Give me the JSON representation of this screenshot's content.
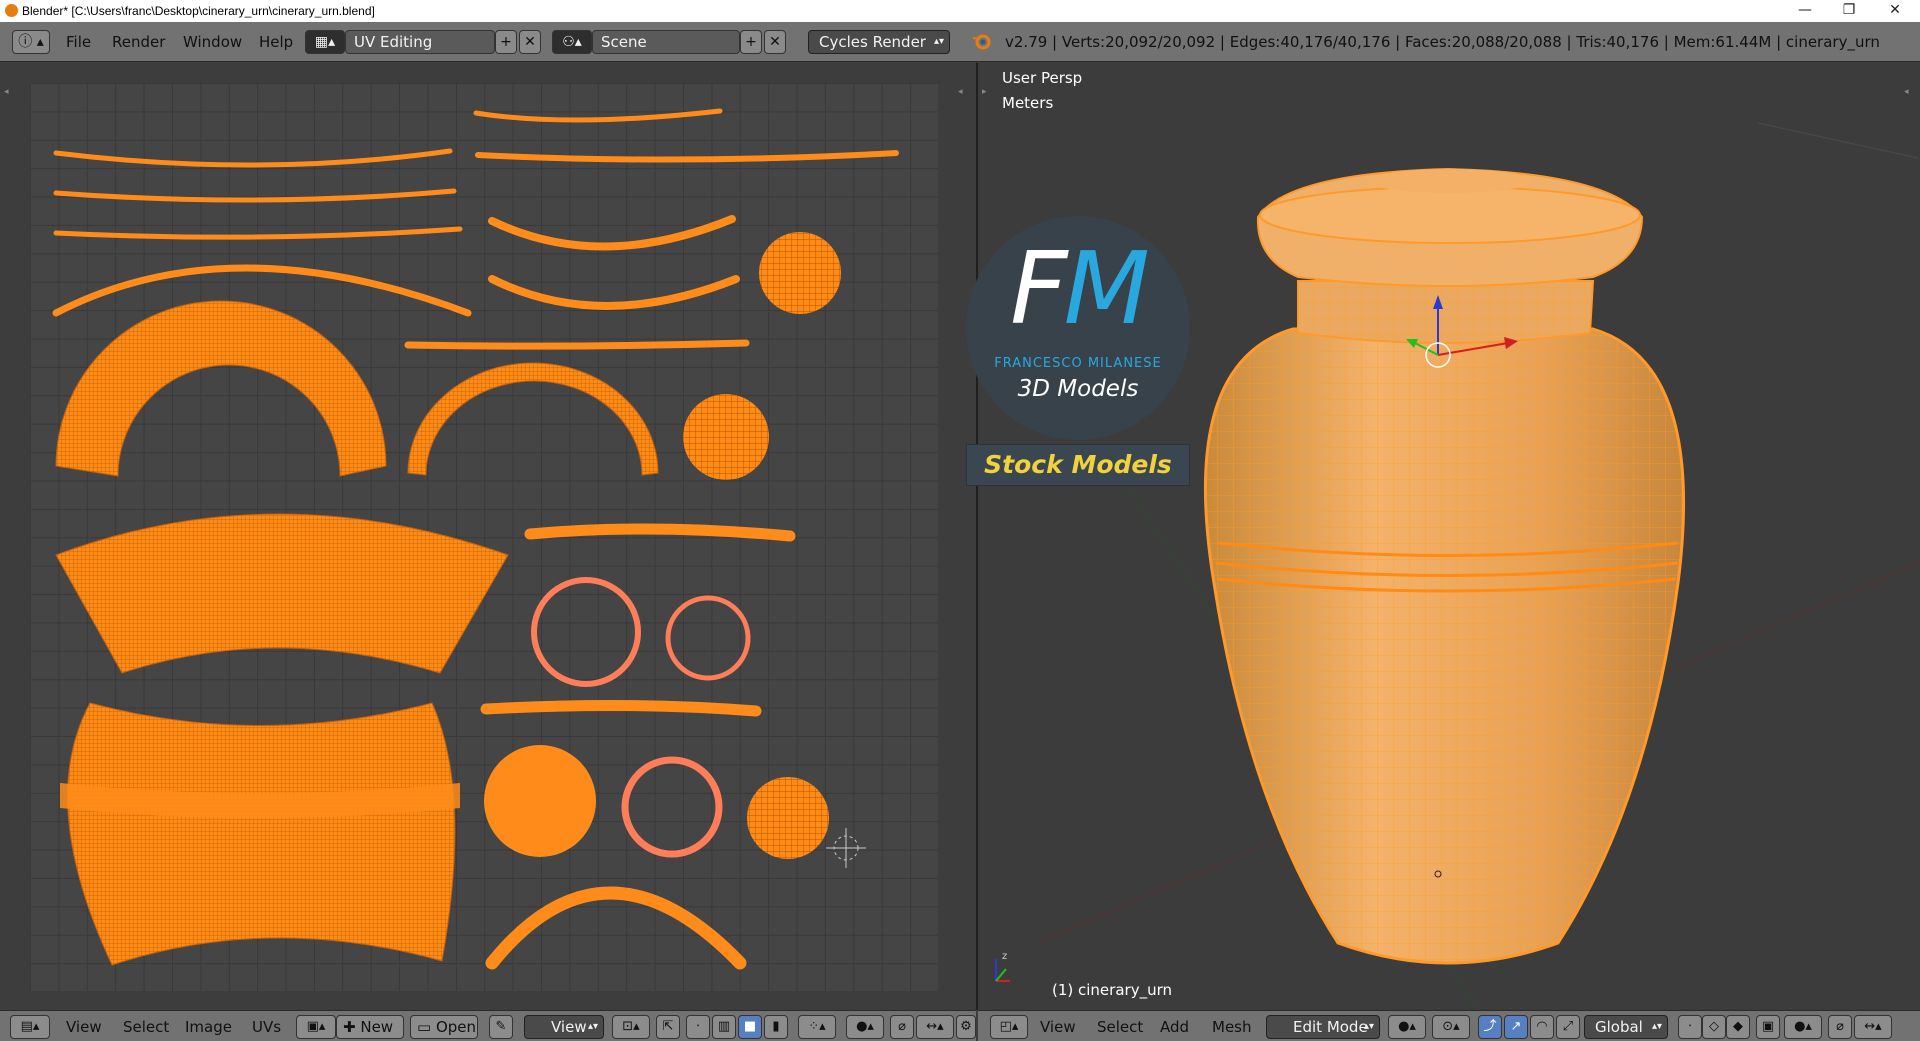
{
  "window": {
    "title": "Blender* [C:\\Users\\franc\\Desktop\\cinerary_urn\\cinerary_urn.blend]",
    "controls": [
      "—",
      "❐",
      "✕"
    ]
  },
  "topbar": {
    "menus": [
      "File",
      "Render",
      "Window",
      "Help"
    ],
    "screen_layout": "UV Editing",
    "scene": "Scene",
    "render_engine": "Cycles Render",
    "stats": "v2.79 | Verts:20,092/20,092 | Edges:40,176/40,176 | Faces:20,088/20,088 | Tris:40,176 | Mem:61.44M | cinerary_urn"
  },
  "uv_editor": {
    "menus": [
      "View",
      "Select",
      "Image",
      "UVs"
    ],
    "new_label": "New",
    "open_label": "Open",
    "view_label": "View"
  },
  "viewport": {
    "view_name": "User Persp",
    "units": "Meters",
    "object_label": "(1) cinerary_urn",
    "menus": [
      "View",
      "Select",
      "Add",
      "Mesh"
    ],
    "mode": "Edit Mode",
    "orientation": "Global"
  },
  "watermark": {
    "logo_letters": "FM",
    "author": "FRANCESCO MILANESE",
    "line": "3D Models",
    "tagline": "Stock Models"
  },
  "colors": {
    "uv_orange": "#ff8c1a",
    "header_gray": "#727272",
    "accent_blue": "#29a8e0",
    "stock_yellow": "#f0d23c"
  }
}
